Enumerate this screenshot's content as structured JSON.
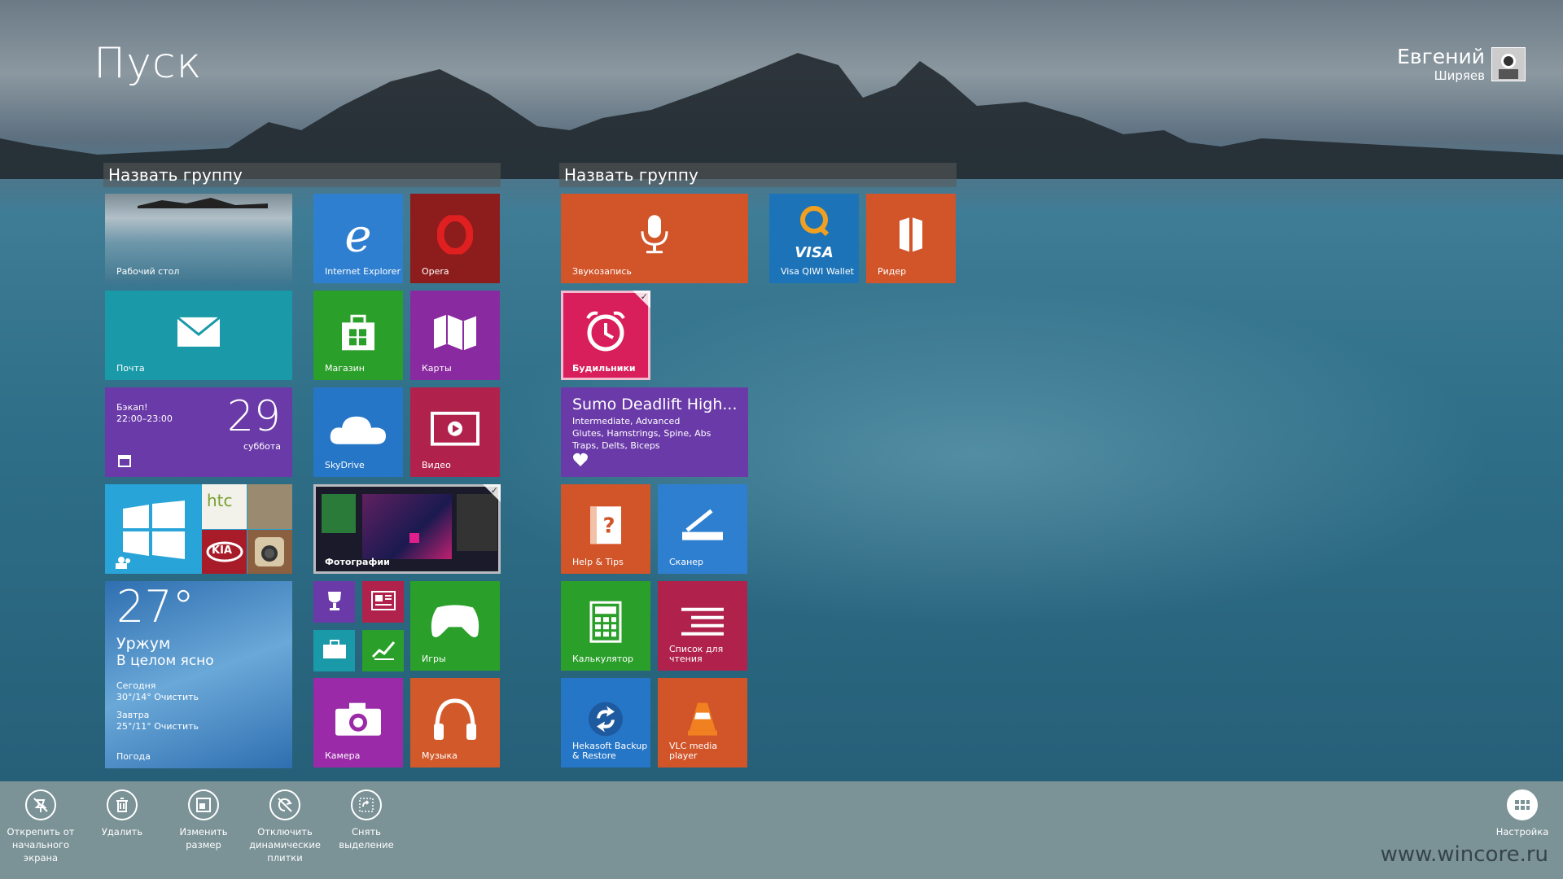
{
  "start": {
    "title": "Пуск"
  },
  "user": {
    "first_name": "Евгений",
    "last_name": "Ширяев"
  },
  "groups": [
    {
      "name": "Назвать группу"
    },
    {
      "name": "Назвать группу"
    }
  ],
  "tiles": {
    "desktop": "Рабочий стол",
    "ie": "Internet Explorer",
    "opera": "Opera",
    "mail": "Почта",
    "store": "Магазин",
    "maps": "Карты",
    "calendar": {
      "event": "Бэкап!",
      "time": "22:00–23:00",
      "day": "29",
      "weekday": "суббота"
    },
    "skydrive": "SkyDrive",
    "video": "Видео",
    "photos": "Фотографии",
    "weather": {
      "temp": "27°",
      "city": "Уржум",
      "desc": "В целом ясно",
      "today_label": "Сегодня",
      "today": "30°/14° Очистить",
      "tomorrow_label": "Завтра",
      "tomorrow": "25°/11° Очистить",
      "name": "Погода"
    },
    "games": "Игры",
    "camera": "Камера",
    "music": "Музыка",
    "sound_recorder": "Звукозапись",
    "qiwi": "Visa QIWI Wallet",
    "reader": "Ридер",
    "alarms": "Будильники",
    "fitness": {
      "title": "Sumo Deadlift High...",
      "line1": "Intermediate, Advanced",
      "line2": "Glutes, Hamstrings, Spine, Abs",
      "line3": "Traps, Delts, Biceps"
    },
    "help": "Help & Tips",
    "scanner": "Сканер",
    "calculator": "Калькулятор",
    "reading_list_1": "Список для",
    "reading_list_2": "чтения",
    "hekasoft_1": "Hekasoft Backup",
    "hekasoft_2": "& Restore",
    "vlc_1": "VLC media",
    "vlc_2": "player",
    "htc_text": "htc",
    "kia_text": "KIA",
    "visa_text": "VISA"
  },
  "appbar": {
    "unpin_1": "Открепить от",
    "unpin_2": "начального",
    "unpin_3": "экрана",
    "uninstall": "Удалить",
    "resize_1": "Изменить",
    "resize_2": "размер",
    "live_1": "Отключить",
    "live_2": "динамические",
    "live_3": "плитки",
    "clear_1": "Снять",
    "clear_2": "выделение",
    "customize": "Настройка"
  },
  "watermark": "www.wincore.ru",
  "colors": {
    "ie": "#2f7fd0",
    "opera": "#8d1c1c",
    "mail": "#1a9aa8",
    "store": "#2a9f2a",
    "maps": "#8a2aa0",
    "calendar": "#6a3aa8",
    "skydrive": "#2676c7",
    "video": "#b0224c",
    "weather": "#2f6fb0",
    "games": "#2a9f2a",
    "camera": "#9a2aa8",
    "music": "#d25a2a",
    "recorder": "#d2552a",
    "qiwi": "#1d73b7",
    "reader": "#d2552a",
    "alarms": "#d81e5b",
    "fitness": "#6a3aa8",
    "help": "#d2552a",
    "scanner": "#2f7fd0",
    "calculator": "#2a9f2a",
    "readinglist": "#b0224c",
    "hekasoft": "#2676c7",
    "vlc": "#d2552a",
    "appbar": "#7b9297"
  }
}
